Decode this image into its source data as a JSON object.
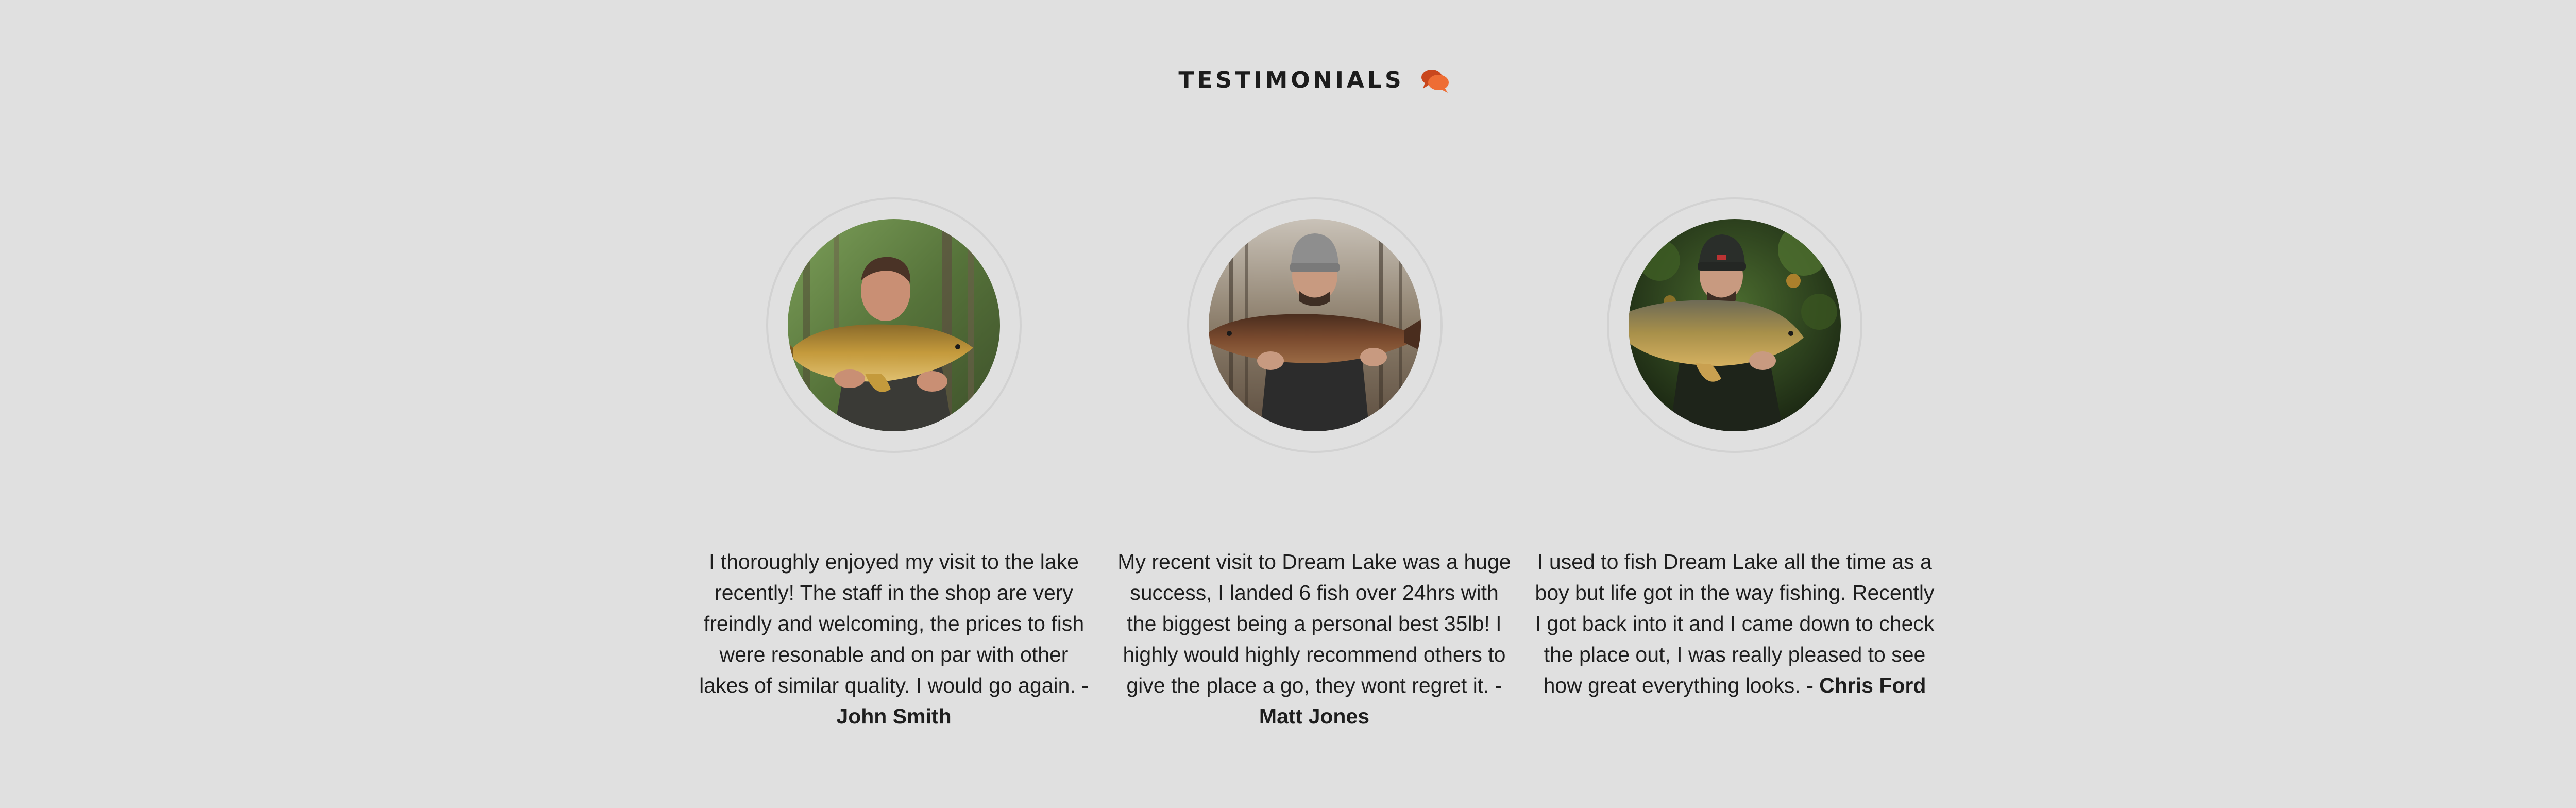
{
  "section": {
    "title": "TESTIMONIALS",
    "icon": "chat-bubbles-icon",
    "accent_color": "#e8622c"
  },
  "testimonials": [
    {
      "quote": "I thoroughly enjoyed my visit to the lake recently! The staff in the shop are very freindly and welcoming, the prices to fish were resonable and on par with other lakes of similar quality. I would go again.",
      "author": "- John Smith",
      "photo": "angler-holding-common-carp"
    },
    {
      "quote": "My recent visit to Dream Lake was a huge success, I landed 6 fish over 24hrs with the biggest being a personal best 35lb! I highly would highly recommend others to give the place a go, they wont regret it.",
      "author": "- Matt Jones",
      "photo": "angler-holding-dark-carp"
    },
    {
      "quote": "I used to fish Dream Lake all the time as a boy but life got in the way fishing. Recently I got back into it and I came down to check the place out, I was really pleased to see how great everything looks.",
      "author": "- Chris Ford",
      "photo": "angler-holding-mirror-carp"
    }
  ]
}
